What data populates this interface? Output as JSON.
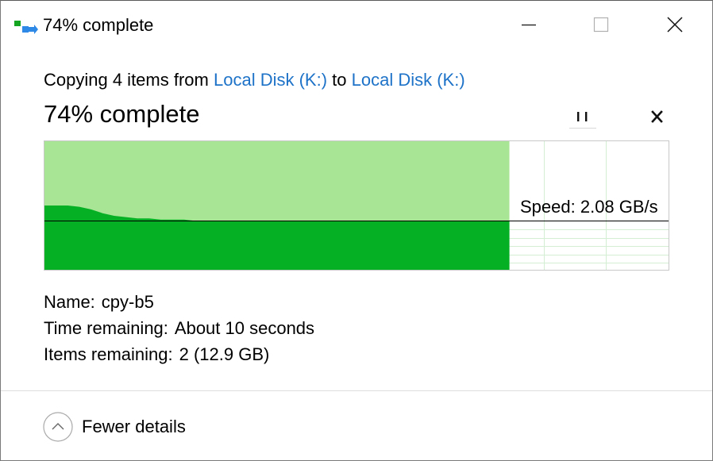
{
  "window": {
    "title": "74% complete",
    "minimize_icon": "minimize-icon",
    "maximize_icon": "maximize-icon",
    "close_icon": "close-icon"
  },
  "copy": {
    "prefix": "Copying 4 items from",
    "source": "Local Disk (K:)",
    "connector": "to",
    "destination": "Local Disk (K:)"
  },
  "progress": {
    "label": "74% complete",
    "percent": 74,
    "pause_icon": "pause-icon",
    "cancel_icon": "close-icon"
  },
  "speed": {
    "label": "Speed: 2.08 GB/s",
    "current_fraction_of_max": 0.38,
    "history_fraction_of_max": [
      0.5,
      0.5,
      0.5,
      0.49,
      0.47,
      0.44,
      0.42,
      0.41,
      0.4,
      0.4,
      0.39,
      0.39,
      0.39,
      0.38,
      0.38,
      0.38,
      0.38,
      0.38,
      0.38,
      0.38,
      0.38,
      0.38,
      0.38,
      0.38,
      0.38,
      0.38,
      0.38,
      0.38,
      0.38,
      0.38,
      0.38,
      0.38,
      0.38,
      0.38,
      0.38,
      0.38,
      0.38,
      0.38,
      0.38,
      0.38,
      0.38
    ]
  },
  "details": {
    "name_label": "Name:",
    "name_value": "cpy-b5",
    "time_label": "Time remaining:",
    "time_value": "About 10 seconds",
    "items_label": "Items remaining:",
    "items_value": "2 (12.9 GB)"
  },
  "footer": {
    "toggle_label": "Fewer details",
    "toggle_icon": "chevron-up-icon"
  },
  "colors": {
    "progress_light": "#a8e595",
    "progress_dark": "#06b025",
    "link": "#1e73c8",
    "graph_grid": "#d4eed4"
  }
}
